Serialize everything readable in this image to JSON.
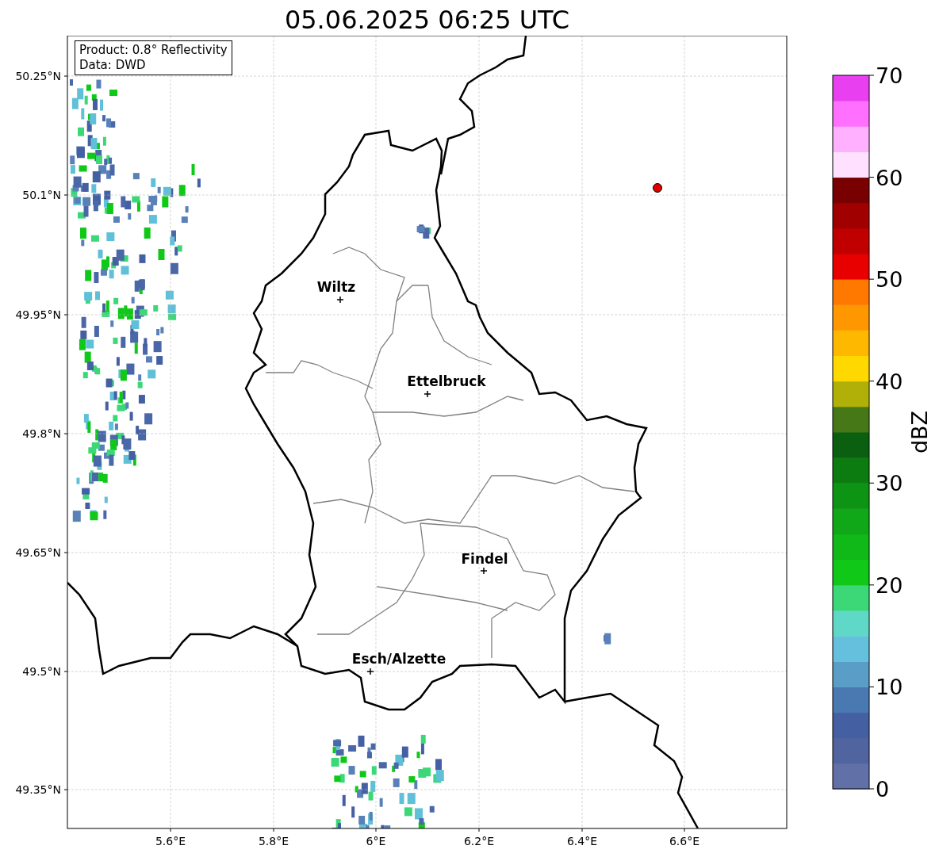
{
  "title": "05.06.2025 06:25 UTC",
  "info": [
    "Product: 0.8° Reflectivity",
    "Data: DWD"
  ],
  "map": {
    "lat_ticks": [
      "50.25°N",
      "50.1°N",
      "49.95°N",
      "49.8°N",
      "49.65°N",
      "49.5°N",
      "49.35°N"
    ],
    "lon_ticks": [
      "5.6°E",
      "5.8°E",
      "6°E",
      "6.2°E",
      "6.4°E",
      "6.6°E"
    ],
    "cities": [
      {
        "name": "Wiltz"
      },
      {
        "name": "Ettelbruck"
      },
      {
        "name": "Findel"
      },
      {
        "name": "Esch/Alzette"
      }
    ]
  },
  "colorbar": {
    "label": "dBZ",
    "ticks": [
      "70",
      "60",
      "50",
      "40",
      "30",
      "20",
      "10",
      "0"
    ],
    "bands": [
      {
        "color": "#6170a6"
      },
      {
        "color": "#5065a0"
      },
      {
        "color": "#4560a2"
      },
      {
        "color": "#4a78b0"
      },
      {
        "color": "#5a9ec8"
      },
      {
        "color": "#64c0dc"
      },
      {
        "color": "#60d8c8"
      },
      {
        "color": "#3cd878"
      },
      {
        "color": "#10c818"
      },
      {
        "color": "#10b818"
      },
      {
        "color": "#10a818"
      },
      {
        "color": "#0e9414"
      },
      {
        "color": "#0c7c10"
      },
      {
        "color": "#0a6010"
      },
      {
        "color": "#467818"
      },
      {
        "color": "#b0b008"
      },
      {
        "color": "#ffd800"
      },
      {
        "color": "#ffb800"
      },
      {
        "color": "#ff9800"
      },
      {
        "color": "#ff7800"
      },
      {
        "color": "#e80000"
      },
      {
        "color": "#c00000"
      },
      {
        "color": "#a00000"
      },
      {
        "color": "#780000"
      },
      {
        "color": "#ffe0ff"
      },
      {
        "color": "#ffb0ff"
      },
      {
        "color": "#ff70ff"
      },
      {
        "color": "#e840f0"
      }
    ]
  }
}
